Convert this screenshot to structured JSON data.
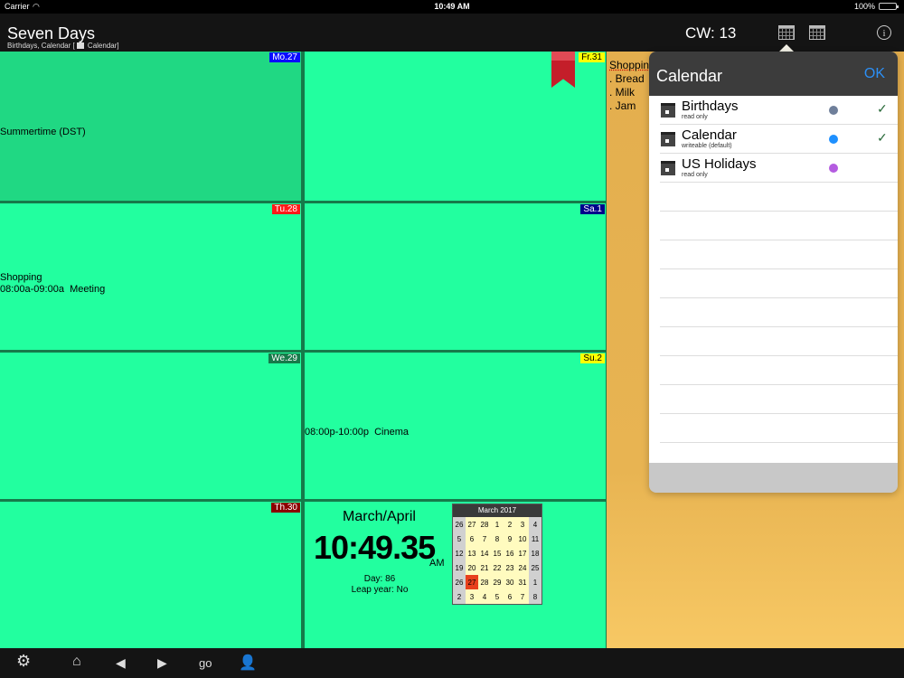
{
  "status_bar": {
    "carrier": "Carrier",
    "time": "10:49 AM",
    "battery": "100%",
    "battery_level": 1.0
  },
  "header": {
    "title": "Seven Days",
    "subtitle_prefix": "Birthdays, Calendar [",
    "subtitle_suffix": " Calendar]",
    "cw": "CW: 13",
    "icons": [
      "calendar-week-icon",
      "calendar-month-icon",
      "info-icon"
    ]
  },
  "days": [
    {
      "label": "Mo.27",
      "label_bg": "#0a0aff",
      "label_fg": "#ffffff",
      "events": [
        "Summertime (DST)"
      ]
    },
    {
      "label": "Tu.28",
      "label_bg": "#ff1a1a",
      "label_fg": "#ffffff",
      "events": [
        "Shopping",
        "08:00a-09:00a  Meeting"
      ]
    },
    {
      "label": "We.29",
      "label_bg": "#167a4a",
      "label_fg": "#ffffff",
      "events": []
    },
    {
      "label": "Th.30",
      "label_bg": "#8b0000",
      "label_fg": "#ffffff",
      "events": []
    },
    {
      "label": "Fr.31",
      "label_bg": "#ffff00",
      "label_fg": "#000000",
      "events": []
    },
    {
      "label": "Sa.1",
      "label_bg": "#00008b",
      "label_fg": "#ffffff",
      "events": []
    },
    {
      "label": "Su.2",
      "label_bg": "#ffff00",
      "label_fg": "#000000",
      "events": [
        "08:00p-10:00p  Cinema"
      ]
    }
  ],
  "clock": {
    "month_title": "March/April",
    "time": "10:49.35",
    "ampm": "AM",
    "day": "Day: 86",
    "leap": "Leap year: No"
  },
  "mini_calendar": {
    "title": "March 2017",
    "rows": [
      [
        "26",
        "27",
        "28",
        "1",
        "2",
        "3",
        "4"
      ],
      [
        "5",
        "6",
        "7",
        "8",
        "9",
        "10",
        "11"
      ],
      [
        "12",
        "13",
        "14",
        "15",
        "16",
        "17",
        "18"
      ],
      [
        "19",
        "20",
        "21",
        "22",
        "23",
        "24",
        "25"
      ],
      [
        "26",
        "27",
        "28",
        "29",
        "30",
        "31",
        "1"
      ],
      [
        "2",
        "3",
        "4",
        "5",
        "6",
        "7",
        "8"
      ]
    ],
    "current": "27"
  },
  "notes": [
    "Shopping",
    ". Bread",
    ". Milk",
    ". Jam"
  ],
  "popover": {
    "title": "Calendar",
    "ok": "OK",
    "calendars": [
      {
        "name": "Birthdays",
        "sub": "read only",
        "color": "#6f7f9a",
        "checked": true
      },
      {
        "name": "Calendar",
        "sub": "writeable (default)",
        "color": "#1e90ff",
        "checked": true
      },
      {
        "name": "US Holidays",
        "sub": "read only",
        "color": "#b45ce0",
        "checked": false
      }
    ],
    "check_glyph": "✓"
  },
  "toolbar": {
    "go": "go",
    "icons": [
      "gear-icon",
      "home-icon",
      "prev-icon",
      "next-icon",
      "user-icon"
    ]
  }
}
